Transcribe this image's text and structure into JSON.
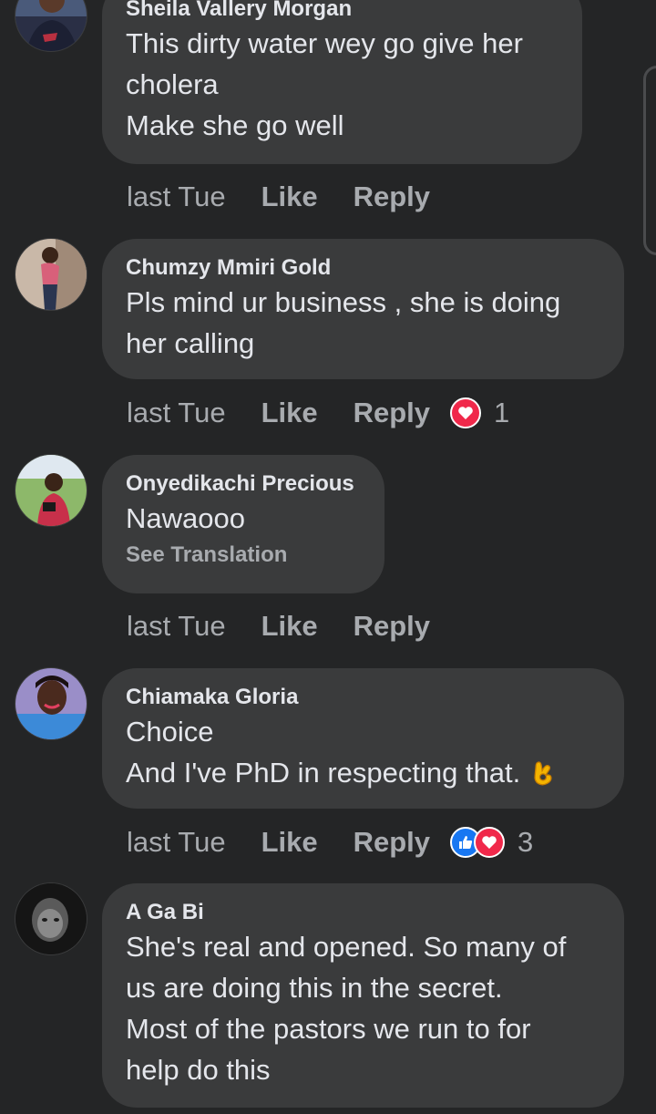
{
  "comments": [
    {
      "author": "Sheila Vallery Morgan",
      "lines": [
        "This dirty water wey go give her",
        "cholera",
        "Make she go well"
      ],
      "time": "last Tue",
      "like_label": "Like",
      "reply_label": "Reply"
    },
    {
      "author": "Chumzy Mmiri Gold",
      "lines": [
        "Pls mind ur business , she is doing",
        "her calling"
      ],
      "time": "last Tue",
      "like_label": "Like",
      "reply_label": "Reply",
      "reactions": [
        "love"
      ],
      "reaction_count": "1"
    },
    {
      "author": "Onyedikachi Precious",
      "lines": [
        "Nawaooo"
      ],
      "see_translation": "See Translation",
      "time": "last Tue",
      "like_label": "Like",
      "reply_label": "Reply"
    },
    {
      "author": "Chiamaka Gloria",
      "lines": [
        "Choice",
        "And I've PhD in respecting that."
      ],
      "emoji": "ok-hand-emoji",
      "time": "last Tue",
      "like_label": "Like",
      "reply_label": "Reply",
      "reactions": [
        "like",
        "love"
      ],
      "reaction_count": "3"
    },
    {
      "author": "A Ga Bi",
      "lines": [
        "She's real and opened. So many of",
        "us are doing this in the secret.",
        "Most of the pastors we run to for",
        "help do this"
      ]
    }
  ],
  "colors": {
    "background": "#242526",
    "bubble": "#3a3b3c",
    "text_primary": "#e4e6eb",
    "text_secondary": "#a8abaf",
    "love_reaction": "#f0284a",
    "like_reaction": "#1877f2"
  }
}
